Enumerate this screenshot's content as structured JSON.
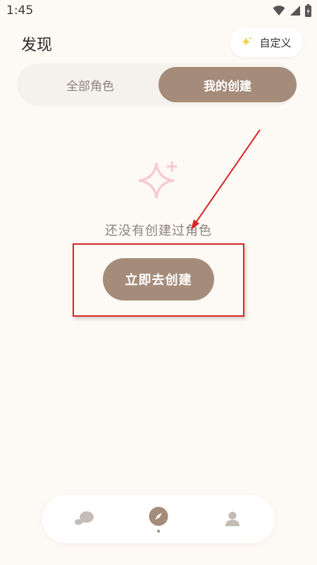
{
  "status_bar": {
    "time": "1:45",
    "icons": [
      "wifi-icon",
      "signal-icon",
      "battery-icon"
    ]
  },
  "header": {
    "title": "发现",
    "custom_button": {
      "label": "自定义",
      "icon": "sparkle-icon",
      "icon_color": "#f1d24a"
    }
  },
  "tabs": [
    {
      "label": "全部角色",
      "active": false
    },
    {
      "label": "我的创建",
      "active": true
    }
  ],
  "empty_state": {
    "icon": "sparkle-icon",
    "icon_color": "#f8c9cf",
    "message": "还没有创建过角色",
    "action_label": "立即去创建"
  },
  "annotations": {
    "color": "#d6262a",
    "items": [
      "arrow",
      "highlight-box"
    ]
  },
  "bottom_nav": {
    "items": [
      {
        "icon": "chat-icon",
        "active": false
      },
      {
        "icon": "compass-icon",
        "active": true
      },
      {
        "icon": "user-icon",
        "active": false
      }
    ]
  },
  "colors": {
    "accent": "#a58c7a",
    "background": "#fdf9f4"
  }
}
